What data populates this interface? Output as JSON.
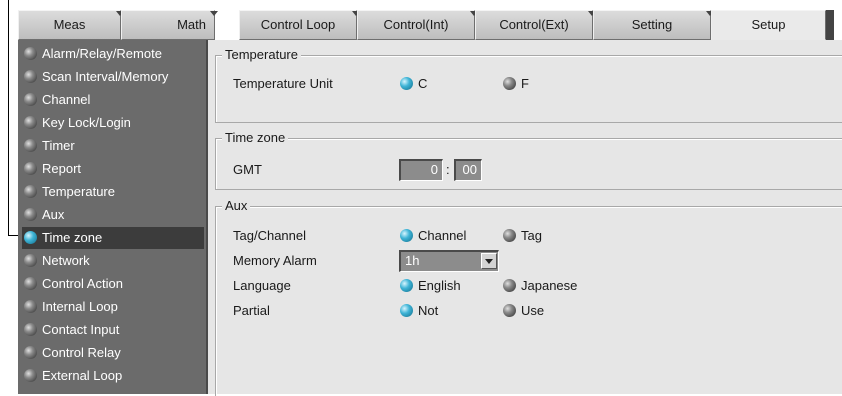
{
  "tabs": [
    {
      "label": "Meas"
    },
    {
      "label": "Math"
    },
    {
      "label": "Control Loop"
    },
    {
      "label": "Control(Int)"
    },
    {
      "label": "Control(Ext)"
    },
    {
      "label": "Setting"
    },
    {
      "label": "Setup",
      "active": true
    }
  ],
  "sidebar": {
    "items": [
      {
        "label": "Alarm/Relay/Remote"
      },
      {
        "label": "Scan Interval/Memory"
      },
      {
        "label": "Channel"
      },
      {
        "label": "Key Lock/Login"
      },
      {
        "label": "Timer"
      },
      {
        "label": "Report"
      },
      {
        "label": "Temperature"
      },
      {
        "label": "Aux"
      },
      {
        "label": "Time zone",
        "selected": true
      },
      {
        "label": "Network"
      },
      {
        "label": "Control Action"
      },
      {
        "label": "Internal Loop"
      },
      {
        "label": "Contact Input"
      },
      {
        "label": "Control Relay"
      },
      {
        "label": "External Loop"
      }
    ]
  },
  "temperature": {
    "title": "Temperature",
    "unit_label": "Temperature Unit",
    "options": [
      "C",
      "F"
    ],
    "selected": "C"
  },
  "timezone": {
    "title": "Time zone",
    "gmt_label": "GMT",
    "hours": "0",
    "separator": ":",
    "minutes": "00"
  },
  "aux": {
    "title": "Aux",
    "tag_channel": {
      "label": "Tag/Channel",
      "options": [
        "Channel",
        "Tag"
      ],
      "selected": "Channel"
    },
    "memory_alarm": {
      "label": "Memory Alarm",
      "value": "1h"
    },
    "language": {
      "label": "Language",
      "options": [
        "English",
        "Japanese"
      ],
      "selected": "English"
    },
    "partial": {
      "label": "Partial",
      "options": [
        "Not",
        "Use"
      ],
      "selected": "Not"
    }
  },
  "colors": {
    "sidebar_bg": "#6b6b6b",
    "selected_bg": "#3c3c3c",
    "radio_on": "#3fb4d6",
    "content_bg": "#e6e6e6"
  }
}
